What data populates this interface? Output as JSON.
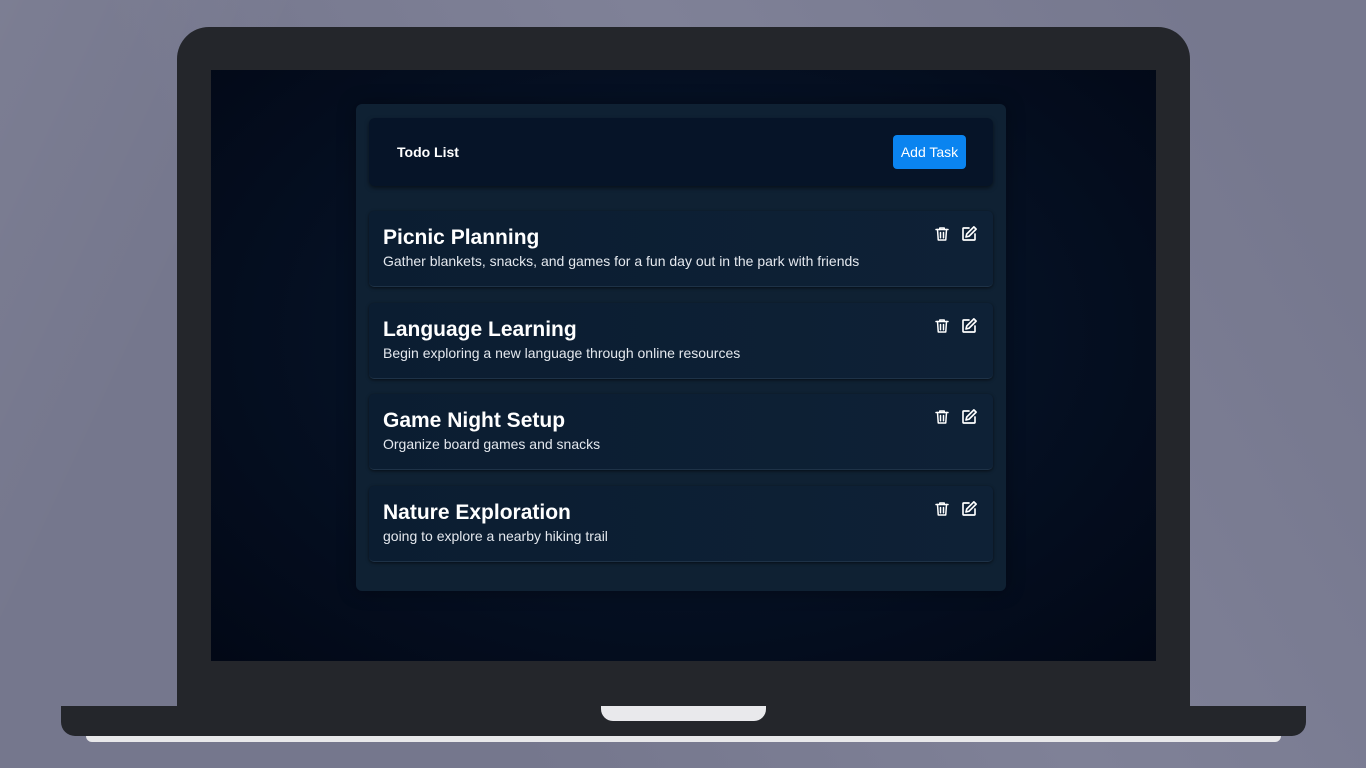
{
  "app": {
    "title": "Todo List",
    "add_button_label": "Add Task"
  },
  "tasks": [
    {
      "title": "Picnic Planning",
      "description": "Gather blankets, snacks, and games for a fun day out in the park with friends"
    },
    {
      "title": "Language Learning",
      "description": "Begin exploring a new language through online resources"
    },
    {
      "title": "Game Night Setup",
      "description": "Organize board games and snacks"
    },
    {
      "title": "Nature Exploration",
      "description": "going to explore a nearby hiking trail"
    }
  ],
  "icons": {
    "delete": "trash-icon",
    "edit": "edit-icon"
  },
  "colors": {
    "accent": "#0a84f0",
    "background": "#7a7c93",
    "panel": "#0f2133",
    "screen": "#061226"
  }
}
